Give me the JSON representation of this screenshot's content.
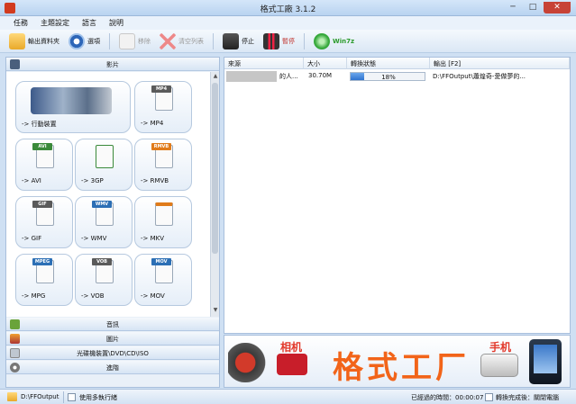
{
  "window": {
    "title": "格式工廠 3.1.2",
    "minimize": "─",
    "maximize": "□",
    "close": "✕"
  },
  "menu": [
    "任務",
    "主題設定",
    "語言",
    "說明"
  ],
  "toolbar": {
    "output_folder": "輸出資料夾",
    "options": "選項",
    "remove": "移除",
    "clear_list": "清空列表",
    "stop": "停止",
    "pause": "暫停",
    "win7": "Win7z"
  },
  "categories": {
    "video": "影片",
    "audio": "音訊",
    "picture": "圖片",
    "rom": "光碟機裝置\\DVD\\CD\\ISO",
    "advanced": "進階"
  },
  "tiles": [
    {
      "label": "-> 行動裝置",
      "tag": ""
    },
    {
      "label": "-> MP4",
      "tag": "MP4",
      "color": "#4d4d4d"
    },
    {
      "label": "-> AVI",
      "tag": "AVI",
      "color": "#3a8a3a"
    },
    {
      "label": "-> 3GP",
      "tag": "",
      "color": "#3a8a3a"
    },
    {
      "label": "-> RMVB",
      "tag": "RMVB",
      "color": "#e07b1a"
    },
    {
      "label": "-> GIF",
      "tag": "GIF",
      "color": "#4d4d4d"
    },
    {
      "label": "-> WMV",
      "tag": "WMV",
      "color": "#2c6fb5"
    },
    {
      "label": "-> MKV",
      "tag": "",
      "color": "#e07b1a"
    },
    {
      "label": "-> MPG",
      "tag": "MPEG",
      "color": "#2c6fb5"
    },
    {
      "label": "-> VOB",
      "tag": "VOB",
      "color": "#4d4d4d"
    },
    {
      "label": "-> MOV",
      "tag": "MOV",
      "color": "#2c6fb5"
    }
  ],
  "list": {
    "headers": {
      "source": "來源",
      "size": "大小",
      "status": "轉換狀態",
      "output": "輸出 [F2]"
    },
    "rows": [
      {
        "source": "的人...",
        "size": "30.70M",
        "progress": 18,
        "progress_text": "18%",
        "output": "D:\\FFOutput\\蕭煌奇-愛做夢的..."
      }
    ]
  },
  "banner": {
    "camera": "相机",
    "main": "格式工厂",
    "phone": "手机"
  },
  "status": {
    "path": "D:\\FFOutput",
    "multithread": "使用多執行緒",
    "elapsed": "已經過的時間：00:00:07",
    "after_convert": "轉換完成後：關閉電腦"
  }
}
